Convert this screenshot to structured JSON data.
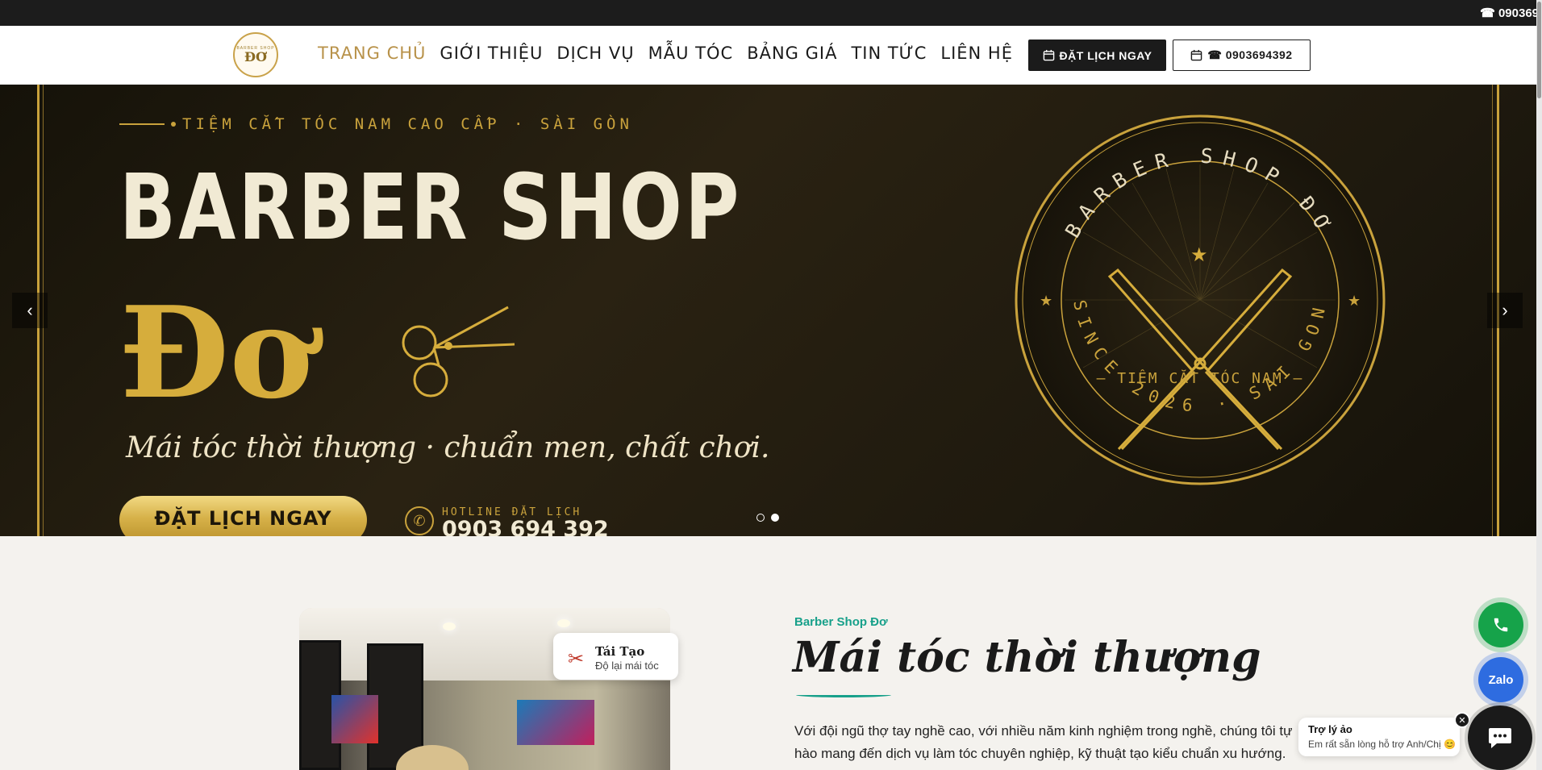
{
  "topbar": {
    "phone": "☎ 090369"
  },
  "header": {
    "logo_mark": "ĐƠ",
    "logo_small": "BARBER SHOP",
    "nav": [
      {
        "label": "TRANG CHỦ"
      },
      {
        "label": "GIỚI THIỆU"
      },
      {
        "label": "DỊCH VỤ"
      },
      {
        "label": "MẪU TÓC"
      },
      {
        "label": "BẢNG GIÁ"
      },
      {
        "label": "TIN TỨC"
      },
      {
        "label": "LIÊN HỆ"
      }
    ],
    "book_button": "ĐẶT LỊCH NGAY",
    "phone_button": "☎ 0903694392"
  },
  "hero": {
    "tagline": "TIỆM CẮT TÓC NAM CAO CẤP · SÀI GÒN",
    "title": "BARBER SHOP",
    "brand": "Đơ",
    "slogan": "Mái tóc thời thượng · chuẩn men, chất chơi.",
    "cta": "ĐẶT LỊCH NGAY",
    "hotline_label": "HOTLINE ĐẶT LỊCH",
    "hotline_number": "0903 694 392",
    "emblem": {
      "ring_top": "BARBER SHOP ĐƠ",
      "center": "— TIỆM CẮT TÓC NAM —",
      "ring_bottom": "SINCE 2026 · SAI GON",
      "prev_arrow": "‹",
      "next_arrow": "›"
    },
    "slides_total": 2,
    "active_slide": 2
  },
  "about": {
    "badge_title": "Tái Tạo",
    "badge_sub": "Độ lại mái tóc",
    "kicker": "Barber Shop Đơ",
    "heading": "Mái tóc thời thượng",
    "text": "Với đội ngũ thợ tay nghề cao, với nhiều năm kinh nghiệm trong nghề, chúng tôi tự hào mang đến dịch vụ làm tóc chuyên nghiệp, kỹ thuật tạo kiểu chuẩn xu hướng."
  },
  "widgets": {
    "zalo_label": "Zalo",
    "chat_title": "Trợ lý ảo",
    "chat_sub": "Em rất sẵn lòng hỗ trợ Anh/Chị 😊",
    "close_icon": "✕"
  },
  "colors": {
    "gold": "#c9a23c",
    "teal": "#17a08a",
    "dark": "#1b1b1b"
  }
}
